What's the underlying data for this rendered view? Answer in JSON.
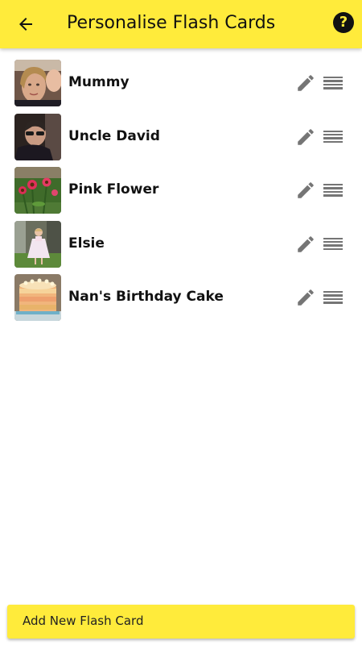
{
  "header": {
    "title": "Personalise Flash Cards",
    "back_icon": "arrow-left-icon",
    "help_icon": "help-circle-icon",
    "help_glyph": "?"
  },
  "cards": [
    {
      "label": "Mummy"
    },
    {
      "label": "Uncle David"
    },
    {
      "label": "Pink Flower"
    },
    {
      "label": "Elsie"
    },
    {
      "label": "Nan's Birthday Cake"
    }
  ],
  "row_icons": {
    "edit": "pencil-icon",
    "reorder": "drag-handle-icon"
  },
  "footer": {
    "add_label": "Add New Flash Card"
  },
  "colors": {
    "accent": "#ffeb3b",
    "icon_grey": "#757575",
    "text": "#111111"
  }
}
